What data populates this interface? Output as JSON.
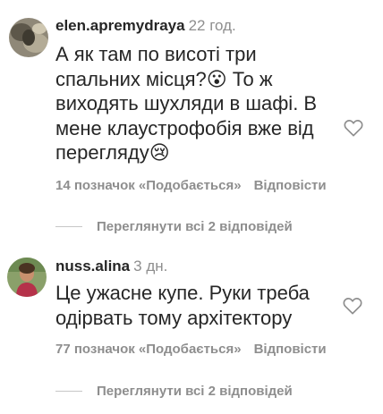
{
  "comments": [
    {
      "username": "elen.apremydraya",
      "time": "22 год.",
      "text_lines": [
        "А як там по висоті три",
        "спальних місця?😮 То ж",
        "виходять шухляди в шафі. В",
        "мене клаустрофобія вже від",
        "перегляду😢"
      ],
      "likes": "14 позначок «Подобається»",
      "reply_label": "Відповісти",
      "view_replies": "Переглянути всі 2 відповідей",
      "icons": {
        "like": "heart-outline-icon"
      }
    },
    {
      "username": "nuss.alina",
      "time": "3 дн.",
      "text_lines": [
        "Це ужасне купе. Руки треба",
        "одірвать тому архітектору"
      ],
      "likes": "77 позначок «Подобається»",
      "reply_label": "Відповісти",
      "view_replies": "Переглянути всі 2 відповідей",
      "icons": {
        "like": "heart-outline-icon"
      }
    }
  ],
  "colors": {
    "text": "#262626",
    "muted": "#8e8e8e",
    "divider": "#c7c7c7"
  }
}
